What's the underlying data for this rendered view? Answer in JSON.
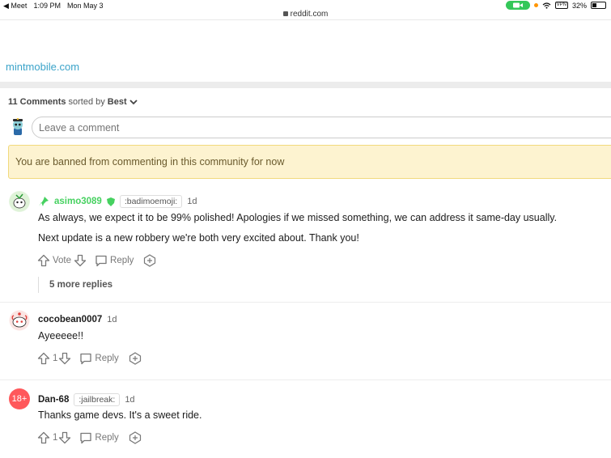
{
  "status_bar": {
    "back_app": "◀ Meet",
    "time": "1:09 PM",
    "date": "Mon May 3",
    "vpn": "VPN",
    "battery": "32%",
    "battery_level": 0.32
  },
  "browser": {
    "url": "reddit.com"
  },
  "post": {
    "link": "mintmobile.com"
  },
  "comments_header": {
    "count": "11 Comments",
    "sorted_by": "sorted by",
    "sort": "Best"
  },
  "composer": {
    "placeholder": "Leave a comment"
  },
  "ban_notice": "You are banned from commenting in this community for now",
  "comments": [
    {
      "user": "asimo3089",
      "flair": ":badimoemoji:",
      "age": "1d",
      "paragraphs": [
        "As always, we expect it to be 99% polished! Apologies if we missed something, we can address it same-day usually.",
        "Next update is a new robbery we're both very excited about. Thank you!"
      ],
      "vote_label": "Vote",
      "reply_label": "Reply",
      "more_replies": "5 more replies"
    },
    {
      "user": "cocobean0007",
      "age": "1d",
      "paragraphs": [
        "Ayeeeee!!"
      ],
      "votes": "1",
      "reply_label": "Reply"
    },
    {
      "user": "Dan-68",
      "flair": ":jailbreak:",
      "age": "1d",
      "avatar_text": "18+",
      "paragraphs": [
        "Thanks game devs. It's a sweet ride."
      ],
      "votes": "1",
      "reply_label": "Reply"
    }
  ],
  "colors": {
    "mod_green": "#46d160",
    "link_blue": "#3aa3c9",
    "ban_bg": "#fdf3d0",
    "nsfw_red": "#ff585b"
  }
}
